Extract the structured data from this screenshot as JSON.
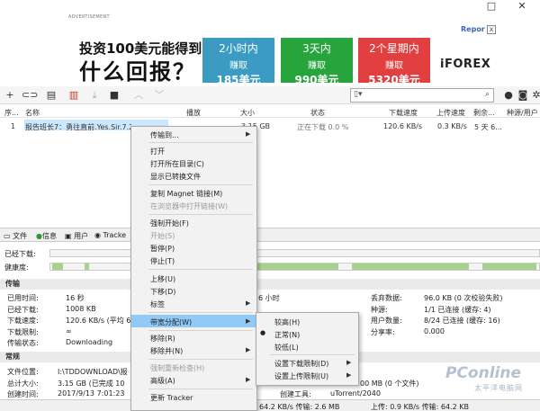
{
  "window": {
    "restore": "□",
    "close": "✕"
  },
  "ad": {
    "label": "ADVERTISEMENT",
    "report": "Repor",
    "close": "x",
    "headline1": "投资100美元能得到",
    "headline2": "什么回报？",
    "boxes": [
      {
        "l1": "2小时内",
        "l2": "赚取",
        "l3": "185美元",
        "color": "#3b9bc3"
      },
      {
        "l1": "3天内",
        "l2": "赚取",
        "l3": "990美元",
        "color": "#27a53c"
      },
      {
        "l1": "2个星期内",
        "l2": "赚取",
        "l3": "5320美元",
        "color": "#e24040"
      }
    ],
    "logo": "iFOREX"
  },
  "list": {
    "headers": {
      "num": "序...",
      "name": "名称",
      "play": "播放",
      "size": "大小",
      "status": "状态",
      "down": "下载速度",
      "up": "上传速度",
      "remain": "剩余...",
      "seeds": "种源/用户"
    },
    "rows": [
      {
        "num": "1",
        "name": "报告班长7：勇往直前.Yes.Sir.7.2016.1080",
        "size": "3.15 GB",
        "status": "正在下载 0.0 %",
        "down": "120.6 KB/s",
        "up": "0.3 KB/s",
        "remain": "5 天 6..."
      }
    ]
  },
  "tabs": {
    "files": "文件",
    "info": "信息",
    "peers": "用户",
    "trackers": "Tracke"
  },
  "bars": {
    "downloaded": "已经下载:",
    "availability": "健康度:"
  },
  "transfer": {
    "heading": "传输",
    "left": [
      {
        "k": "已用时间:",
        "v": "16 秒"
      },
      {
        "k": "已经下载:",
        "v": "1008 KB"
      },
      {
        "k": "下载速度:",
        "v": "120.6 KB/s (平均 6"
      },
      {
        "k": "下载限制:",
        "v": "∞"
      },
      {
        "k": "传输状态:",
        "v": "Downloading"
      }
    ],
    "mid": "6 小时",
    "right": [
      {
        "k": "丢弃数据:",
        "v": "96.0 KB (0 次校验失败)"
      },
      {
        "k": "种源:",
        "v": "1/1 已连接 (缓存: 4)"
      },
      {
        "k": "用户数量:",
        "v": "8/24 已连接 (缓存: 16)"
      },
      {
        "k": "分享率:",
        "v": "0.000"
      }
    ]
  },
  "general": {
    "heading": "常规",
    "save_k": "文件位置:",
    "save_v": "I:\\TDDOWNLOAD\\报",
    "size_k": "总计大小:",
    "size_v": "3.15 GB (已完成 10",
    "size_tail": "00 MB (0 个文件)",
    "created_k": "创建时间:",
    "created_v": "2017/9/13 7:01:23",
    "tool_k": "创建工具:",
    "tool_v": "uTorrent/2040",
    "footer_left": "64.2 KB/s 传输: 2.6 MB",
    "footer_right": "上传: 0.9 KB/s 传输: 64.2 KB"
  },
  "context_menu": {
    "items": [
      {
        "label": "传输到...",
        "arrow": true
      },
      {
        "label": "打开"
      },
      {
        "label": "打开所在目录(C)"
      },
      {
        "label": "显示已转换文件"
      },
      {
        "label": "复制 Magnet 链接(M)"
      },
      {
        "label": "在浏览器中打开链接(W)",
        "disabled": true
      },
      {
        "label": "强制开始(F)"
      },
      {
        "label": "开始(S)",
        "disabled": true
      },
      {
        "label": "暂停(P)"
      },
      {
        "label": "停止(T)"
      },
      {
        "label": "上移(U)"
      },
      {
        "label": "下移(D)"
      },
      {
        "label": "标签",
        "arrow": true
      },
      {
        "label": "带宽分配(W)",
        "arrow": true
      },
      {
        "label": "移除(R)"
      },
      {
        "label": "移除并(N)",
        "arrow": true
      },
      {
        "label": "强制重新检查(H)",
        "disabled": true
      },
      {
        "label": "高级(A)",
        "arrow": true
      },
      {
        "label": "更新 Tracker"
      }
    ]
  },
  "submenu": {
    "items": [
      {
        "label": "较高(H)"
      },
      {
        "label": "正常(N)",
        "checked": true
      },
      {
        "label": "较低(L)"
      },
      {
        "label": "设置下载限制(D)",
        "arrow": true
      },
      {
        "label": "设置上传限制(U)",
        "arrow": true
      }
    ]
  },
  "watermark": {
    "brand": "PConline",
    "sub": "太平洋电脑网"
  }
}
